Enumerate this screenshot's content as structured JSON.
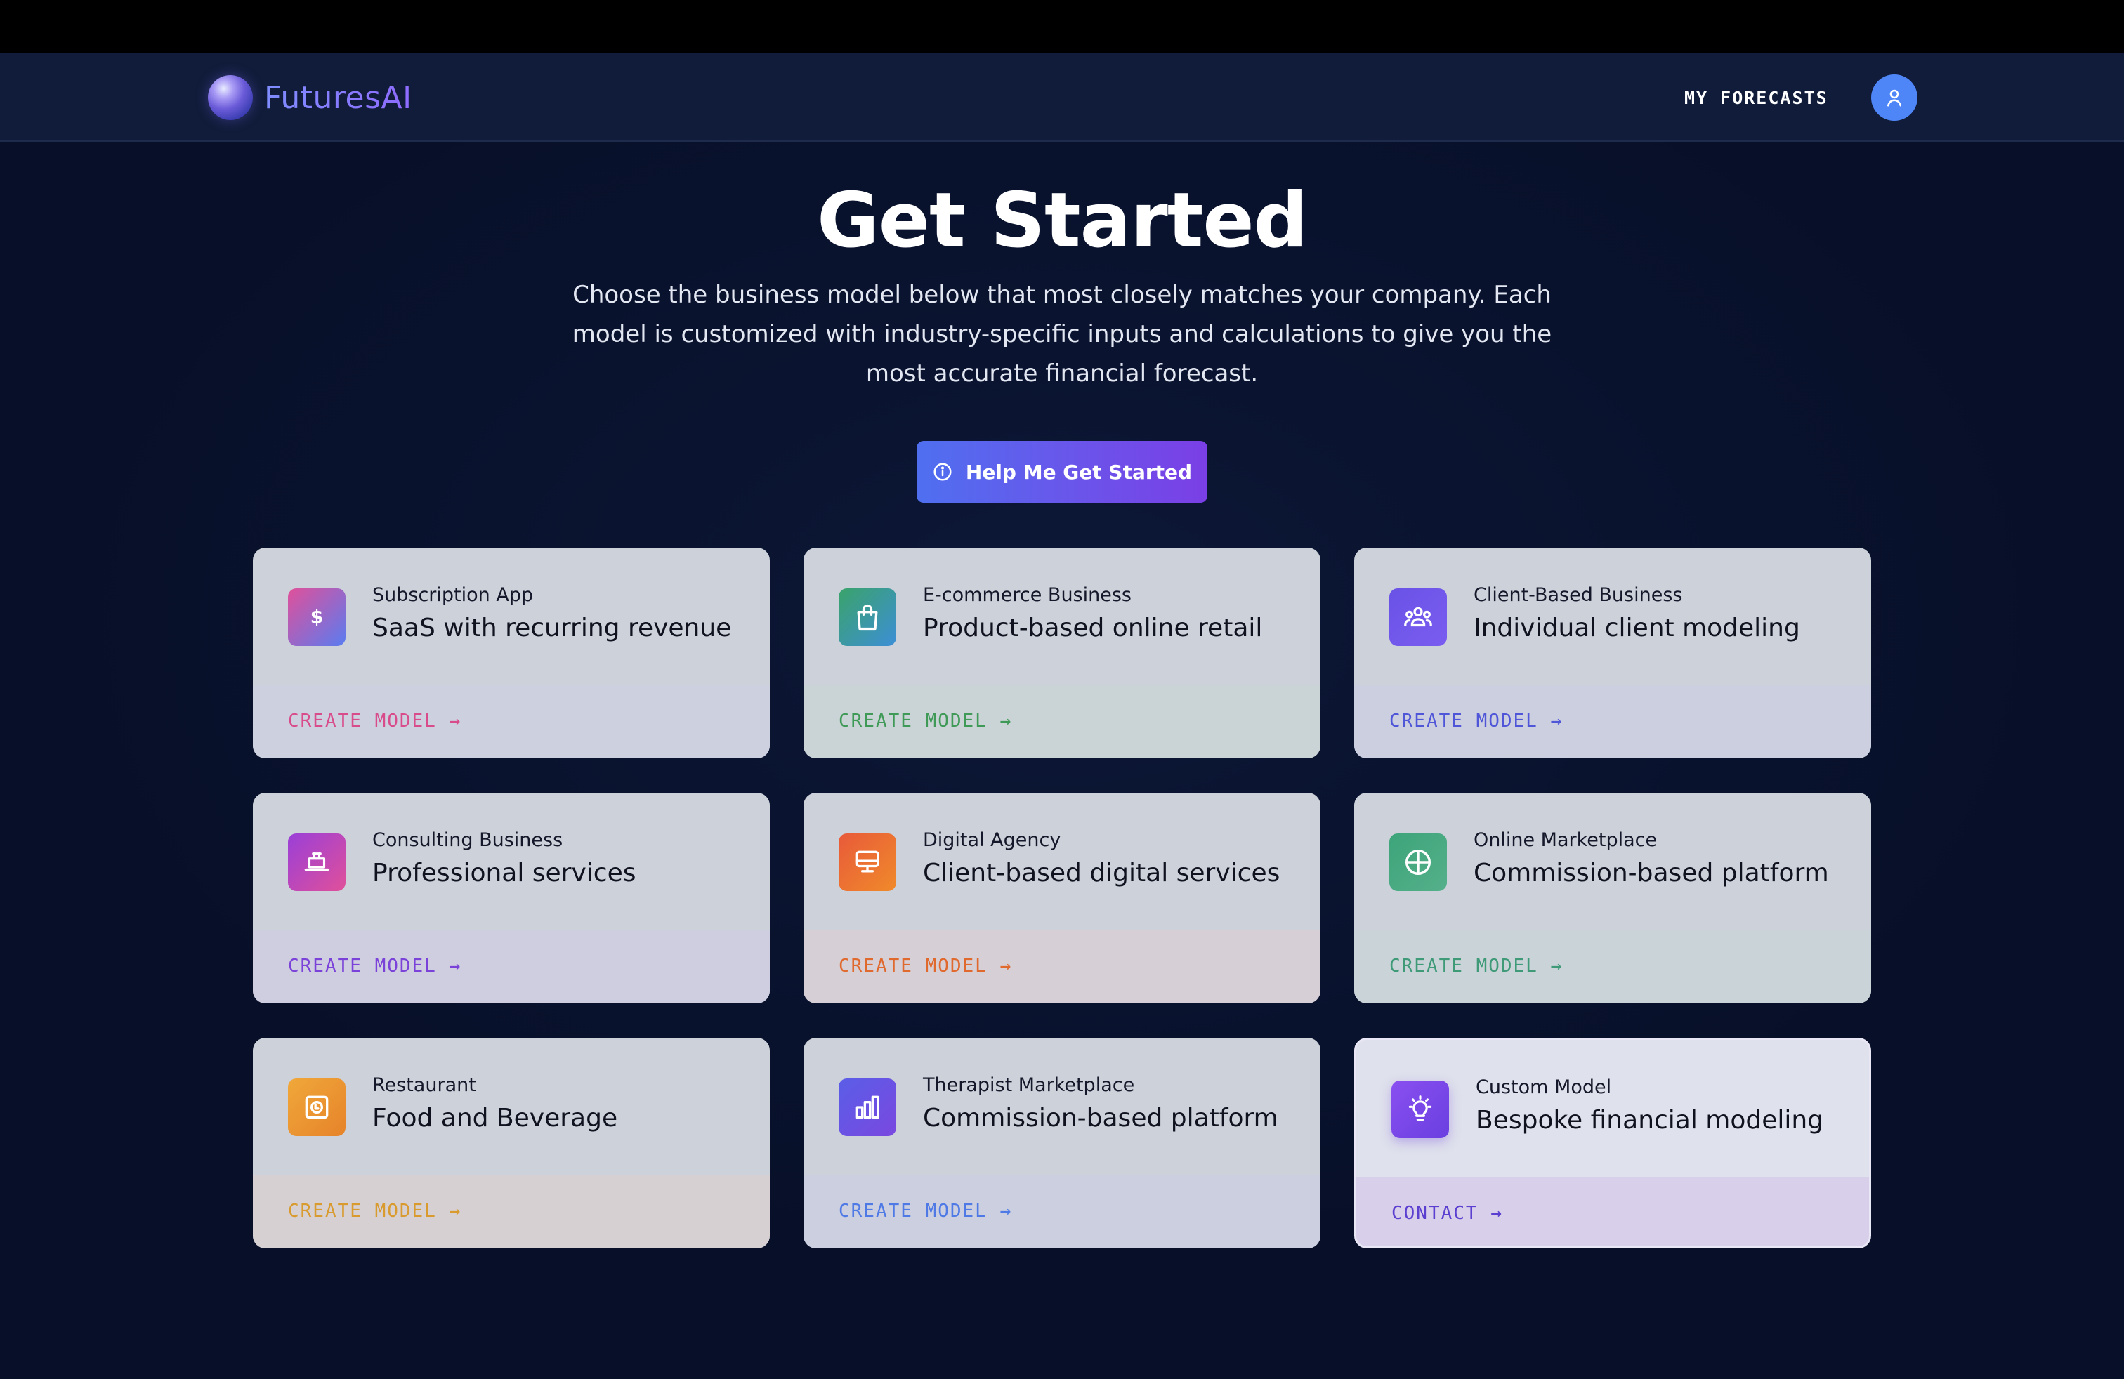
{
  "brand": {
    "name": "FuturesAI"
  },
  "nav": {
    "my_forecasts": "MY FORECASTS"
  },
  "hero": {
    "title": "Get Started",
    "subtitle": "Choose the business model below that most closely matches your company. Each model is customized with industry-specific inputs and calculations to give you the most accurate financial forecast.",
    "cta_label": "Help Me Get Started"
  },
  "cards": [
    {
      "category": "Subscription App",
      "title": "SaaS with recurring revenue",
      "action": "CREATE MODEL →",
      "icon": "dollar-icon",
      "accent": "#d94c8c",
      "gradient": [
        "#e0509a",
        "#5a7cf0"
      ],
      "foot_tint": "#cdd0df"
    },
    {
      "category": "E-commerce Business",
      "title": "Product-based online retail",
      "action": "CREATE MODEL →",
      "icon": "shopping-bag-icon",
      "accent": "#3f9a58",
      "gradient": [
        "#3aa36a",
        "#3d8fd6"
      ],
      "foot_tint": "#cad3d5"
    },
    {
      "category": "Client-Based Business",
      "title": "Individual client modeling",
      "action": "CREATE MODEL →",
      "icon": "users-icon",
      "accent": "#4f56d8",
      "gradient": [
        "#6a52e6",
        "#7a5df0"
      ],
      "foot_tint": "#cccfe0"
    },
    {
      "category": "Consulting Business",
      "title": "Professional services",
      "action": "CREATE MODEL →",
      "icon": "briefcase-icon",
      "accent": "#7a42d8",
      "gradient": [
        "#9a3fd8",
        "#e0509a"
      ],
      "foot_tint": "#cfcde0"
    },
    {
      "category": "Digital Agency",
      "title": "Client-based digital services",
      "action": "CREATE MODEL →",
      "icon": "monitor-icon",
      "accent": "#e0692e",
      "gradient": [
        "#e85a3a",
        "#f08a2a"
      ],
      "foot_tint": "#d6cfd6"
    },
    {
      "category": "Online Marketplace",
      "title": "Commission-based platform",
      "action": "CREATE MODEL →",
      "icon": "globe-icon",
      "accent": "#3f9a78",
      "gradient": [
        "#3da47a",
        "#55b08a"
      ],
      "foot_tint": "#cad3d8"
    },
    {
      "category": "Restaurant",
      "title": "Food and Beverage",
      "action": "CREATE MODEL →",
      "icon": "plate-icon",
      "accent": "#d99a2e",
      "gradient": [
        "#f0a83a",
        "#e6832a"
      ],
      "foot_tint": "#d6d0d2"
    },
    {
      "category": "Therapist Marketplace",
      "title": "Commission-based platform",
      "action": "CREATE MODEL →",
      "icon": "bar-chart-icon",
      "accent": "#4f7ae6",
      "gradient": [
        "#5a5ee8",
        "#7a48e0"
      ],
      "foot_tint": "#cbcfe0"
    },
    {
      "category": "Custom Model",
      "title": "Bespoke financial modeling",
      "action": "CONTACT →",
      "icon": "lightbulb-icon",
      "accent": "#5b3fd0",
      "gradient": [
        "#8a4ff0",
        "#6a3fe0"
      ],
      "foot_tint": "#d8d0ea"
    }
  ]
}
